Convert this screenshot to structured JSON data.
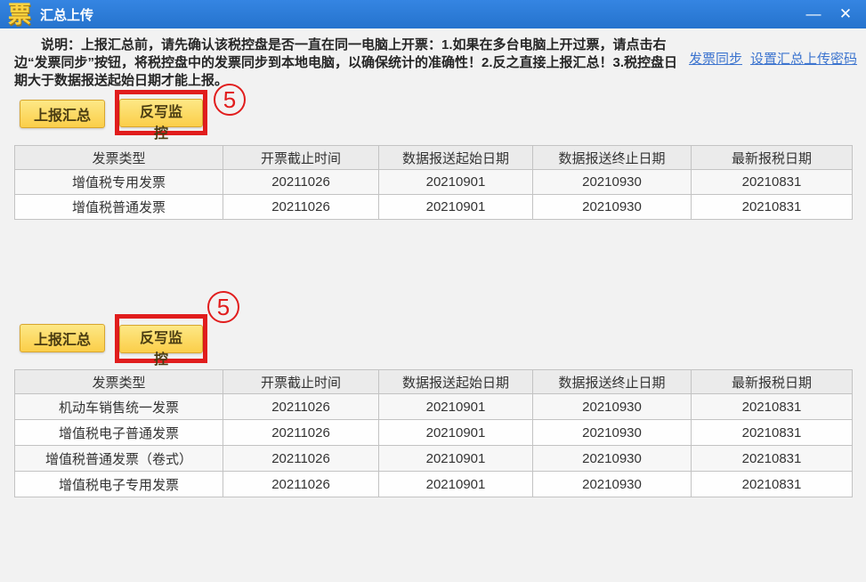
{
  "window": {
    "logo": "票",
    "title": "汇总上传",
    "minimize": "—",
    "close": "✕"
  },
  "colors": {
    "titlebar_blue": "#2a79d3",
    "link_blue": "#3c74cf",
    "button_yellow": "#fbd24e",
    "annotation_red": "#e11d1d"
  },
  "note": {
    "text": "说明：上报汇总前，请先确认该税控盘是否一直在同一电脑上开票：1.如果在多台电脑上开过票，请点击右边“发票同步”按钮，将税控盘中的发票同步到本地电脑，以确保统计的准确性！2.反之直接上报汇总！3.税控盘日期大于数据报送起始日期才能上报。"
  },
  "links": {
    "invoice_sync": "发票同步",
    "set_upload_password": "设置汇总上传密码"
  },
  "sections": [
    {
      "report_button": "上报汇总",
      "writeback_button": "反写监控",
      "annotation": "5",
      "table": {
        "headers": [
          "发票类型",
          "开票截止时间",
          "数据报送起始日期",
          "数据报送终止日期",
          "最新报税日期"
        ],
        "rows": [
          [
            "增值税专用发票",
            "20211026",
            "20210901",
            "20210930",
            "20210831"
          ],
          [
            "增值税普通发票",
            "20211026",
            "20210901",
            "20210930",
            "20210831"
          ]
        ]
      }
    },
    {
      "report_button": "上报汇总",
      "writeback_button": "反写监控",
      "annotation": "5",
      "table": {
        "headers": [
          "发票类型",
          "开票截止时间",
          "数据报送起始日期",
          "数据报送终止日期",
          "最新报税日期"
        ],
        "rows": [
          [
            "机动车销售统一发票",
            "20211026",
            "20210901",
            "20210930",
            "20210831"
          ],
          [
            "增值税电子普通发票",
            "20211026",
            "20210901",
            "20210930",
            "20210831"
          ],
          [
            "增值税普通发票（卷式）",
            "20211026",
            "20210901",
            "20210930",
            "20210831"
          ],
          [
            "增值税电子专用发票",
            "20211026",
            "20210901",
            "20210930",
            "20210831"
          ]
        ]
      }
    }
  ]
}
